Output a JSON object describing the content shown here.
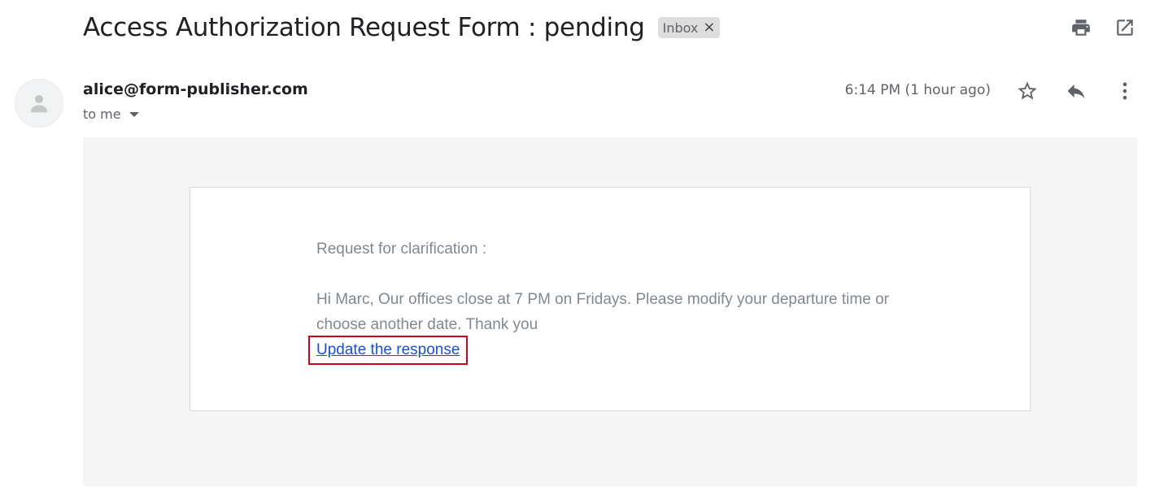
{
  "email": {
    "subject": "Access Authorization Request Form : pending",
    "label": "Inbox",
    "label_remove": "×",
    "sender": "alice@form-publisher.com",
    "recipient": "to me",
    "timestamp": "6:14 PM (1 hour ago)"
  },
  "message": {
    "heading": "Request for clarification :",
    "body": "Hi Marc, Our offices close at 7 PM on Fridays. Please modify your departure time or choose another date. Thank you",
    "link_text": "Update the response"
  },
  "icons": {
    "print": "print-icon",
    "open_new_window": "open-in-new-window-icon",
    "avatar": "default-avatar-icon",
    "star": "star-icon",
    "reply": "reply-icon",
    "more": "more-vertical-icon"
  },
  "colors": {
    "link": "#1a4fd1",
    "highlight_box": "#d0021b",
    "body_background": "#f5f5f5",
    "message_text": "#808891"
  }
}
